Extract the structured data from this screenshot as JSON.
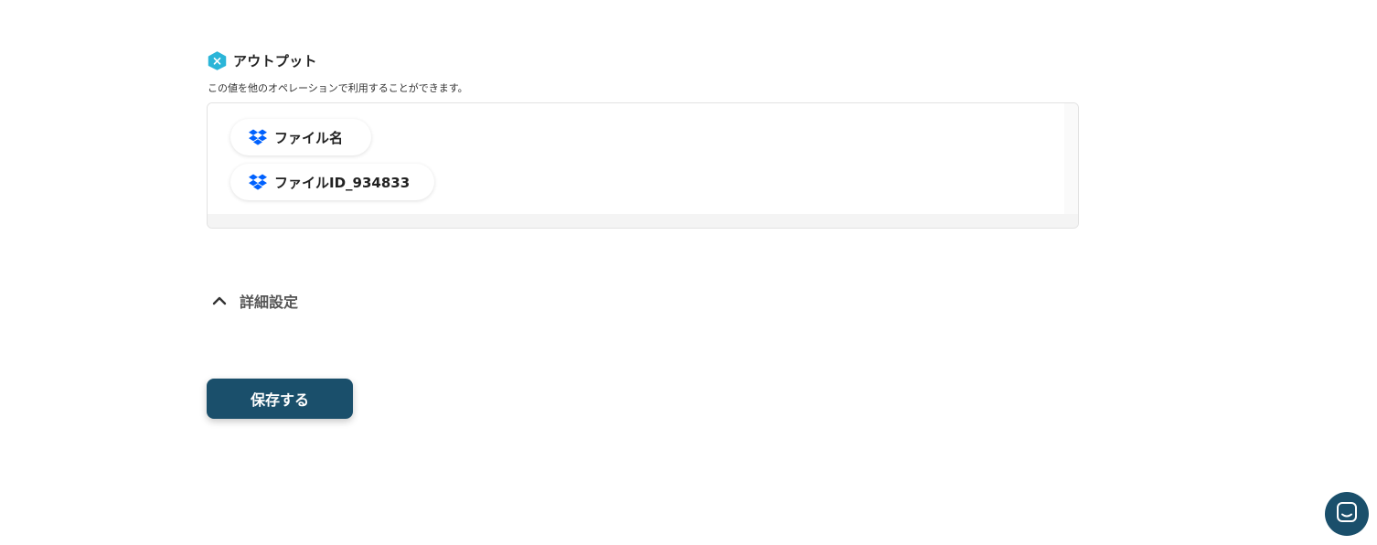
{
  "output": {
    "title": "アウトプット",
    "description": "この値を他のオペレーションで利用することができます。",
    "icon": "hexagon-x-icon",
    "icon_color": "#2bb5d8",
    "items": [
      {
        "label": "ファイル名",
        "icon": "dropbox-icon"
      },
      {
        "label": "ファイルID_934833",
        "icon": "dropbox-icon"
      }
    ]
  },
  "advanced_settings": {
    "label": "詳細設定",
    "icon": "chevron-up-icon",
    "expanded": true
  },
  "save_button": {
    "label": "保存する",
    "color": "#1a4f6b"
  },
  "chat_launcher": {
    "icon": "chat-icon"
  },
  "colors": {
    "dropbox": "#0061fe",
    "primary": "#1a4f6b"
  }
}
